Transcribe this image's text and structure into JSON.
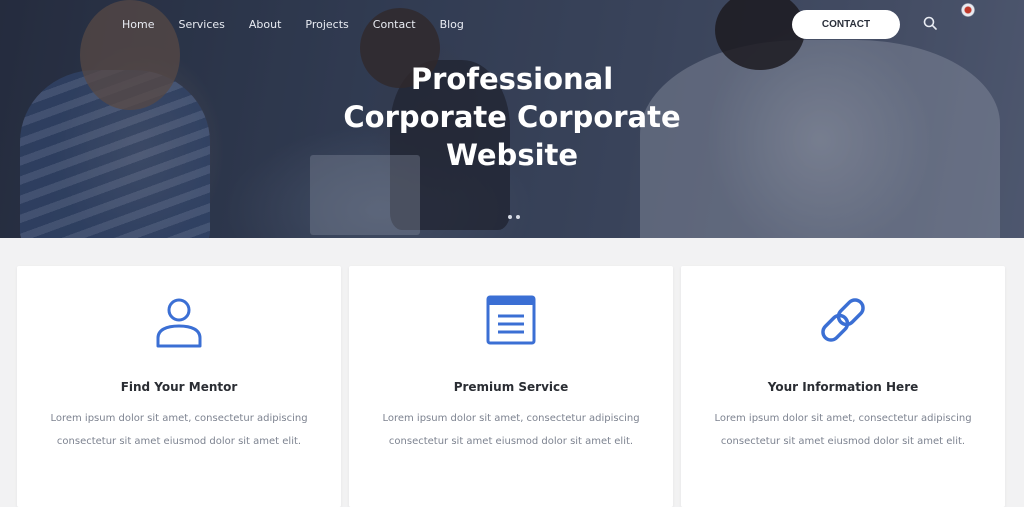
{
  "hero": {
    "nav": [
      {
        "label": "Home"
      },
      {
        "label": "Services"
      },
      {
        "label": "About"
      },
      {
        "label": "Projects"
      },
      {
        "label": "Contact"
      },
      {
        "label": "Blog"
      }
    ],
    "cta_label": "CONTACT",
    "title_line1": "Professional",
    "title_line2": "Corporate Corporate",
    "title_line3": "Website"
  },
  "features": [
    {
      "icon": "user-icon",
      "title": "Find Your Mentor",
      "text": "Lorem ipsum dolor sit amet, consectetur adipiscing consectetur sit amet eiusmod dolor sit amet elit."
    },
    {
      "icon": "document-icon",
      "title": "Premium Service",
      "text": "Lorem ipsum dolor sit amet, consectetur adipiscing consectetur sit amet eiusmod dolor sit amet elit."
    },
    {
      "icon": "link-icon",
      "title": "Your Information Here",
      "text": "Lorem ipsum dolor sit amet, consectetur adipiscing consectetur sit amet eiusmod dolor sit amet elit."
    }
  ],
  "colors": {
    "accent": "#3b6fd4",
    "hero_overlay": "#2b3346",
    "card_bg": "#ffffff",
    "page_bg": "#f2f2f3"
  }
}
